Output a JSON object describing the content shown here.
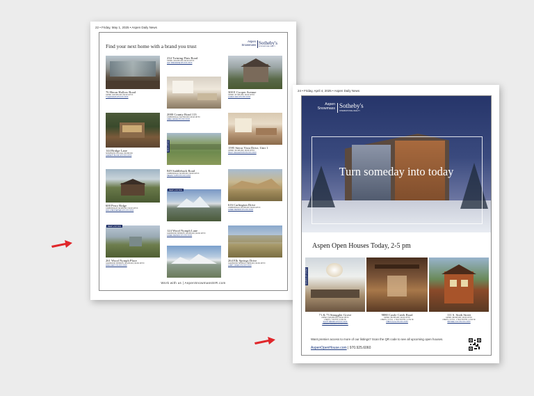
{
  "page1": {
    "header": "22 • Friday, May 1, 2025 • Aspen Daily News",
    "title": "Find your next home with a brand you trust",
    "logo_left": "Aspen Snowmass",
    "logo_right": "Sotheby's",
    "logo_sub": "INTERNATIONAL REALTY",
    "footer": "Work with us | AspenSnowmassSIR.com",
    "listings": [
      {
        "title": "76 Heron Hollow Road",
        "details": "ASPEN | $15,950,000 | MLS# 187XX",
        "contact": "TYLER DAVIS 970.XXX.XXXX"
      },
      {
        "title": "234 Twining Flats Road",
        "details": "ASPEN | $19,950,000 | MLS# 187XX",
        "contact": "LEO TAMURAINE 970.XXX.XXXX"
      },
      {
        "title": "300 E Cooper Avenue",
        "details": "ASPEN | $7,995,000 | MLS# 187XX",
        "contact": "LAURA LANG 970.XXX.XXXX"
      },
      {
        "title": "2000 County Road 113",
        "details": "CARBONDALE | $12,500,000 | MLS# 187XX",
        "contact": "GREG GRAVE 970.XXX.XXXX"
      },
      {
        "title": "144 Bridge Lane",
        "details": "SNOWMASS VILLAGE | $9,995,000",
        "contact": "GARRETT BLOCK 970.XXX.XXXX"
      },
      {
        "title": "1595 Sierra Vista Drive, Unit 1",
        "details": "ASPEN | $3,495,000 | MLS# 187XX",
        "contact": "TRACY EGGLESTON 970.XXX.XXXX"
      },
      {
        "title": "849 Saddleback Road",
        "details": "CARBONDALE | $4,995,000 | MLS# 187XX",
        "contact": "HELENY KUHN 970.XXX.XXXX"
      },
      {
        "title": "600 Perry Ridge",
        "details": "CARBONDALE | $4,995,000 | MLS# 187XX",
        "contact": "RON CHRISTENSEN 970.XXX.XXXX"
      },
      {
        "title": "616 Carlington Drive",
        "details": "CARBONDALE | $3,495,000 | MLS# 187XX",
        "contact": "KAREN PERSON 970.XXX.XXXX"
      },
      {
        "title": "124 Wood Nymph Lane",
        "details": "GLENWOOD SPRINGS | $2,995,000 | MLS# 187XX",
        "contact": "KAREN PERSON 970.XXX.XXXX"
      },
      {
        "title": "261 Wood Nymph Place",
        "details": "GLENWOOD SPRINGS | $3,495,000 | MLS# 187XX",
        "contact": "DANA KENT 970.XXX.XXXX"
      },
      {
        "title": "264 Elk Springs Drive",
        "details": "GLENWOOD SPRINGS | $995,000 | MLS# 187XX",
        "contact": "LARRY JONES 970.XXX.XXXX"
      }
    ],
    "tag_new_listing_1": "NEW LISTING",
    "tag_new_listing_2": "NEW LISTING",
    "vtag": "NEW LISTING"
  },
  "page2": {
    "header": "24 • Friday, April 4, 2025 • Aspen Daily News",
    "logo_left": "Aspen Snowmass",
    "logo_right": "Sotheby's",
    "logo_sub": "INTERNATIONAL REALTY",
    "hero_text": "Turn someday into today",
    "section_title": "Aspen Open Houses Today, 2-5 pm",
    "vtag": "SMUGGLER GROVE",
    "open_houses": [
      {
        "title": "71 & 73 Smuggler Grove",
        "details": "ASPEN | $18,950,000 | MLS# 187XX",
        "line2": "4 BEDS | 7 BATHS | 8,392 SF",
        "contact": "SCOTT BROWN 970.XXX.XXXX",
        "contact2": "DUNCAN CLAUSS 970.XXX.XXXX"
      },
      {
        "title": "9880 Castle Creek Road",
        "details": "ASPEN | $5,495,000 | MLS# 187XX",
        "line2": "4 BEDS | 4 FULL, 1 HALF BATHS | 3,792 SF",
        "contact": "CHRIS KLUG 970.XXX.XXXX"
      },
      {
        "title": "111 S. Sixth Street",
        "details": "ASPEN | $8,995,000 | MLS# 187XX",
        "line2": "4 BEDS | 4 FULL, 1 HALF BATHS | 2,640 SF",
        "contact": "MICHAEL FOX 970.XXX.XXXX"
      }
    ],
    "cta": "Want premier access to more of our listings? Scan the QR code to see all upcoming open houses.",
    "site": "AspenOpenHouse.com",
    "phone": "| 970.925.6060"
  },
  "colors": {
    "navy": "#1e2e66",
    "arrow": "#e0262a",
    "hero_sky": "#3a4a7e"
  }
}
